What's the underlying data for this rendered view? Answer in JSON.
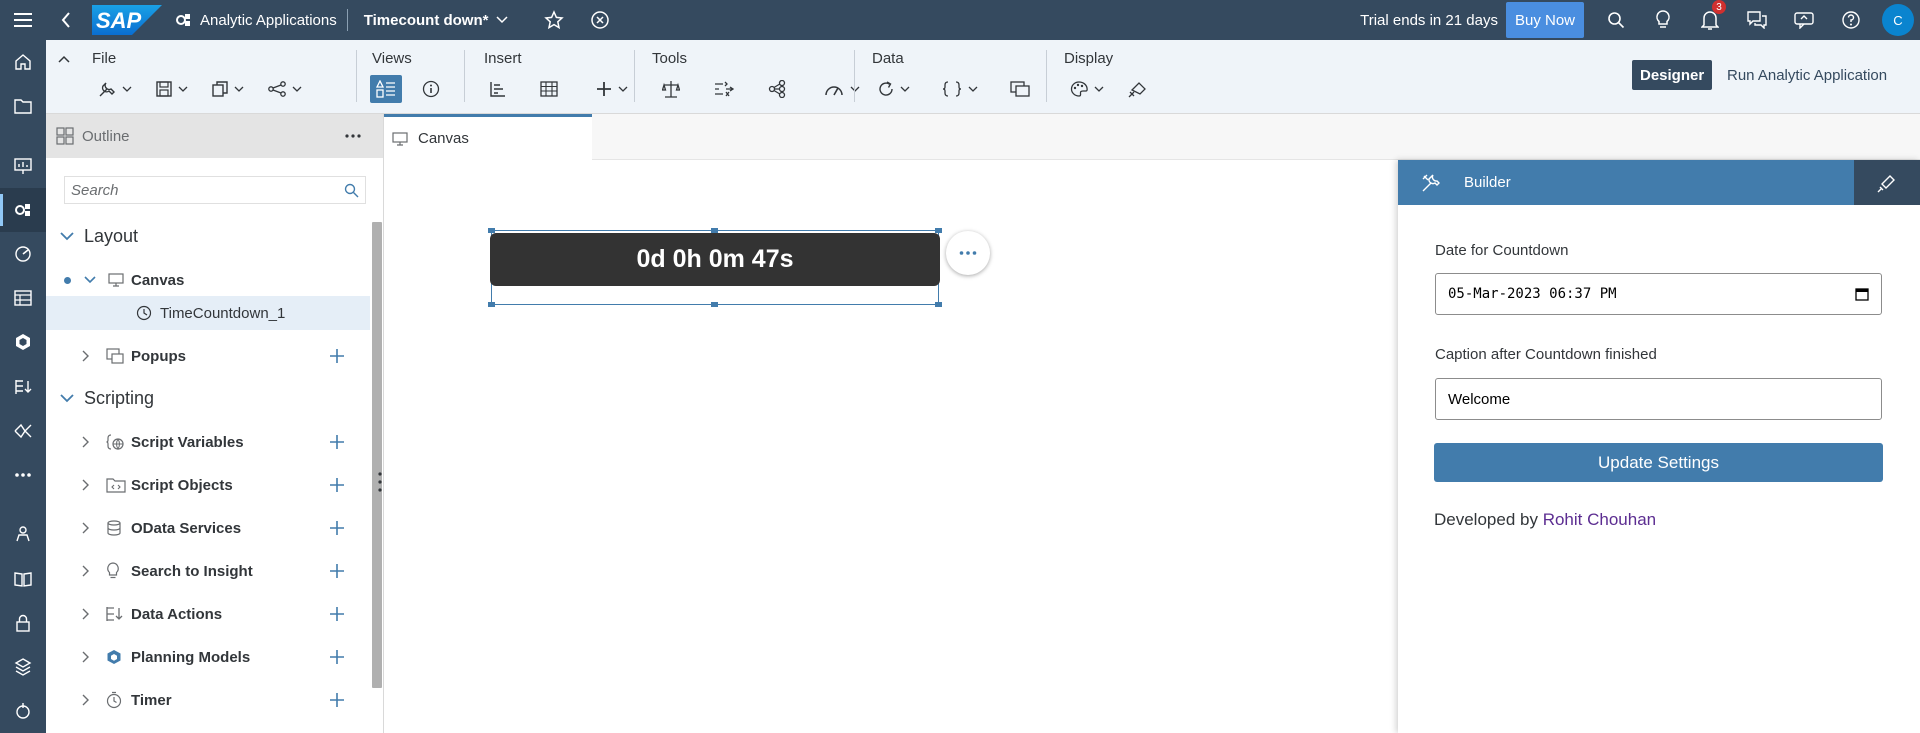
{
  "shell": {
    "logo_text": "SAP",
    "app_name": "Analytic Applications",
    "doc_title": "Timecount down",
    "doc_modified": "*",
    "trial_text": "Trial ends in 21 days",
    "buy_now": "Buy Now",
    "notification_count": "3",
    "avatar_initial": "C"
  },
  "toolbar": {
    "groups": [
      "File",
      "Views",
      "Insert",
      "Tools",
      "Data",
      "Display"
    ],
    "designer_label": "Designer",
    "run_label": "Run Analytic Application"
  },
  "outline": {
    "title": "Outline",
    "search_placeholder": "Search",
    "layout_section": "Layout",
    "scripting_section": "Scripting",
    "items": {
      "canvas": "Canvas",
      "time_countdown": "TimeCountdown_1",
      "popups": "Popups",
      "script_variables": "Script Variables",
      "script_objects": "Script Objects",
      "odata_services": "OData Services",
      "search_to_insight": "Search to Insight",
      "data_actions": "Data Actions",
      "planning_models": "Planning Models",
      "timer": "Timer"
    }
  },
  "canvas": {
    "tab_label": "Canvas",
    "countdown_text": "0d 0h 0m 47s"
  },
  "builder": {
    "title": "Builder",
    "date_label": "Date for Countdown",
    "date_value": "05-Mar-2023 06:37 PM",
    "caption_label": "Caption after Countdown finished",
    "caption_value": "Welcome",
    "update_button": "Update Settings",
    "developed_by_prefix": "Developed by",
    "developer_name": "Rohit Chouhan"
  },
  "colors": {
    "shell_bg": "#354a5f",
    "accent": "#427cac",
    "buy_now_bg": "#4a8ee0",
    "avatar_bg": "#0a84cf",
    "link": "#5c2d91"
  }
}
